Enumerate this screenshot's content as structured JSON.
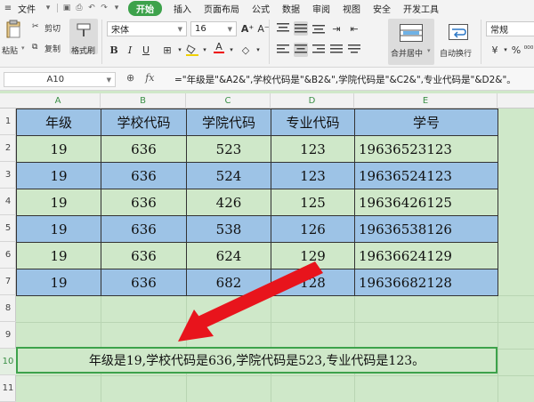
{
  "menubar": {
    "file": "文件",
    "tabs": [
      "开始",
      "插入",
      "页面布局",
      "公式",
      "数据",
      "审阅",
      "视图",
      "安全",
      "开发工具"
    ],
    "active": "开始"
  },
  "ribbon": {
    "paste": "粘贴",
    "cut": "剪切",
    "copy": "复制",
    "format_painter": "格式刷",
    "font_name": "宋体",
    "font_size": "16",
    "merge_center": "合并居中",
    "wrap_text": "自动换行",
    "number_format": "常规",
    "percent": "%",
    "comma_style": "⁰⁰⁰"
  },
  "formula_bar": {
    "name_box": "A10",
    "fx": "fx",
    "formula": "=\"年级是\"&A2&\",学校代码是\"&B2&\",学院代码是\"&C2&\",专业代码是\"&D2&\"。"
  },
  "columns": [
    "A",
    "B",
    "C",
    "D",
    "E"
  ],
  "rows": [
    "1",
    "2",
    "3",
    "4",
    "5",
    "6",
    "7",
    "8",
    "9",
    "10",
    "11"
  ],
  "table": {
    "headers": [
      "年级",
      "学校代码",
      "学院代码",
      "专业代码",
      "学号"
    ],
    "rows": [
      [
        "19",
        "636",
        "523",
        "123",
        "19636523123"
      ],
      [
        "19",
        "636",
        "524",
        "123",
        "19636524123"
      ],
      [
        "19",
        "636",
        "426",
        "125",
        "19636426125"
      ],
      [
        "19",
        "636",
        "538",
        "126",
        "19636538126"
      ],
      [
        "19",
        "636",
        "624",
        "129",
        "19636624129"
      ],
      [
        "19",
        "636",
        "682",
        "128",
        "19636682128"
      ]
    ]
  },
  "result_cell": "年级是19,学校代码是636,学院代码是523,专业代码是123。",
  "colors": {
    "accent": "#3da24b",
    "row_blue": "#9dc3e6",
    "row_green": "#cfe8c9",
    "arrow": "#e8141c"
  }
}
